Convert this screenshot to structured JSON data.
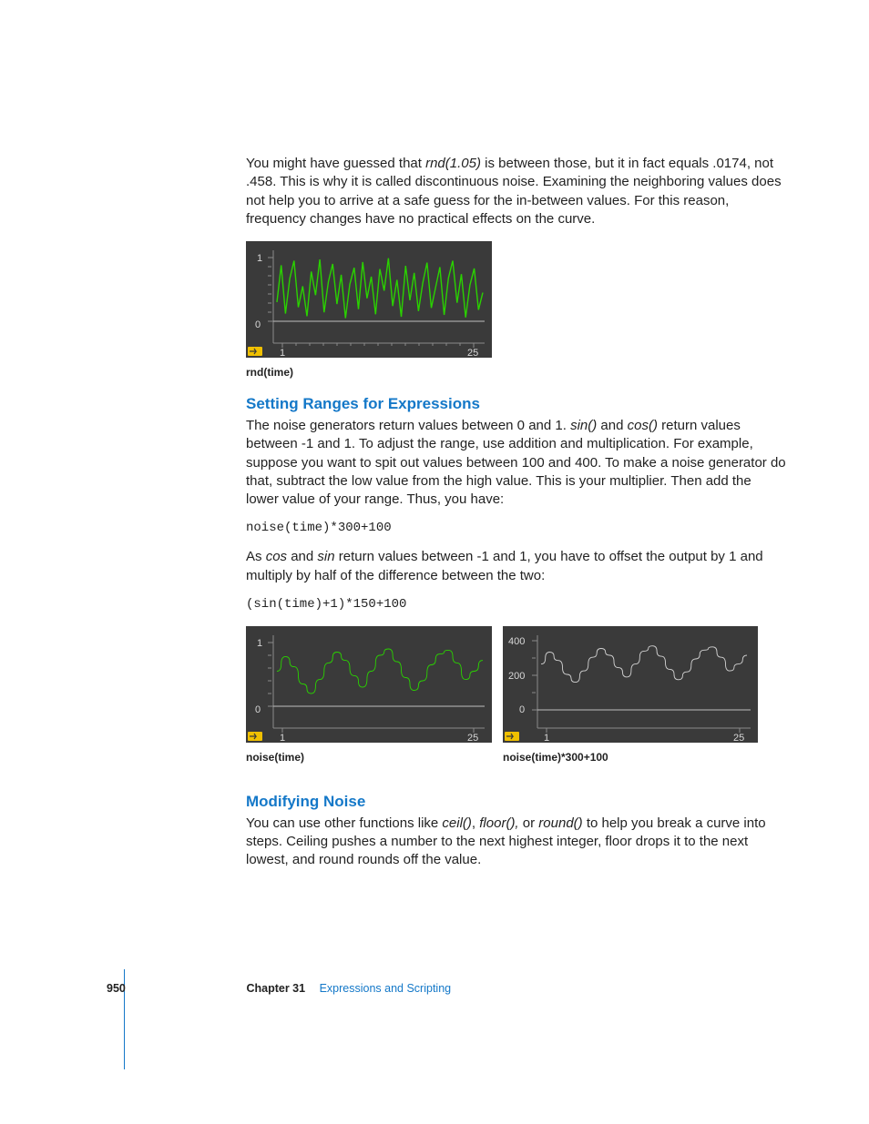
{
  "paragraphs": {
    "intro_a": "You might have guessed that ",
    "intro_rnd": "rnd(1.05)",
    "intro_b": " is between those, but it in fact equals .0174, not .458. This is why it is called discontinuous noise. Examining the neighboring values does not help you to arrive at a safe guess for the in-between values. For this reason, frequency changes have no practical effects on the curve.",
    "ranges_a": "The noise generators return values between 0 and 1. ",
    "ranges_sin": "sin()",
    "ranges_mid": " and ",
    "ranges_cos": "cos()",
    "ranges_b": " return values between -1 and 1. To adjust the range, use addition and multiplication. For example, suppose you want to spit out values between 100 and 400. To make a noise generator do that, subtract the low value from the high value. This is your multiplier. Then add the lower value of your range. Thus, you have:",
    "cos_a": "As ",
    "cos_i": "cos",
    "cos_b": " and ",
    "sin_i": "sin",
    "cos_c": " return values between -1 and 1, you have to offset the output by 1 and multiply by half of the difference between the two:",
    "mod_a": "You can use other functions like ",
    "mod_ceil": "ceil()",
    "mod_s1": ", ",
    "mod_floor": "floor(),",
    "mod_s2": " or ",
    "mod_round": "round()",
    "mod_b": " to help you break a curve into steps. Ceiling pushes a number to the next highest integer, floor drops it to the next lowest, and round rounds off the value."
  },
  "headings": {
    "ranges": "Setting Ranges for Expressions",
    "modify": "Modifying Noise"
  },
  "code": {
    "c1": "noise(time)*300+100",
    "c2": "(sin(time)+1)*150+100"
  },
  "captions": {
    "rnd": "rnd(time)",
    "pair_a": "noise(time)",
    "pair_b": "noise(time)*300+100"
  },
  "footer": {
    "page": "950",
    "chapter": "Chapter 31",
    "title": "Expressions and Scripting"
  },
  "chart_data": [
    {
      "name": "rnd_time",
      "type": "line",
      "title": "rnd(time)",
      "xlabel": "",
      "ylabel": "",
      "xlim": [
        1,
        25
      ],
      "ylim": [
        0,
        1
      ],
      "x_ticks": [
        1,
        25
      ],
      "y_ticks": [
        0,
        1
      ],
      "x": [
        1,
        1.5,
        2,
        2.5,
        3,
        3.5,
        4,
        4.5,
        5,
        5.5,
        6,
        6.5,
        7,
        7.5,
        8,
        8.5,
        9,
        9.5,
        10,
        10.5,
        11,
        11.5,
        12,
        12.5,
        13,
        13.5,
        14,
        14.5,
        15,
        15.5,
        16,
        16.5,
        17,
        17.5,
        18,
        18.5,
        19,
        19.5,
        20,
        20.5,
        21,
        21.5,
        22,
        22.5,
        23,
        23.5,
        24,
        24.5,
        25
      ],
      "y": [
        0.3,
        0.88,
        0.12,
        0.67,
        0.95,
        0.22,
        0.55,
        0.08,
        0.78,
        0.41,
        0.97,
        0.14,
        0.62,
        0.9,
        0.27,
        0.73,
        0.05,
        0.58,
        0.84,
        0.19,
        0.93,
        0.36,
        0.7,
        0.11,
        0.82,
        0.48,
        0.99,
        0.24,
        0.65,
        0.07,
        0.87,
        0.33,
        0.76,
        0.16,
        0.6,
        0.92,
        0.21,
        0.53,
        0.85,
        0.1,
        0.68,
        0.95,
        0.29,
        0.74,
        0.06,
        0.57,
        0.83,
        0.18,
        0.45
      ]
    },
    {
      "name": "noise_time",
      "type": "line",
      "title": "noise(time)",
      "xlabel": "",
      "ylabel": "",
      "xlim": [
        1,
        25
      ],
      "ylim": [
        0,
        1
      ],
      "x_ticks": [
        1,
        25
      ],
      "y_ticks": [
        0,
        1
      ],
      "x": [
        1,
        2,
        3,
        4,
        5,
        6,
        7,
        8,
        9,
        10,
        11,
        12,
        13,
        14,
        15,
        16,
        17,
        18,
        19,
        20,
        21,
        22,
        23,
        24,
        25
      ],
      "y": [
        0.55,
        0.78,
        0.62,
        0.35,
        0.2,
        0.42,
        0.68,
        0.85,
        0.72,
        0.48,
        0.3,
        0.55,
        0.8,
        0.9,
        0.7,
        0.45,
        0.25,
        0.4,
        0.65,
        0.82,
        0.88,
        0.68,
        0.42,
        0.55,
        0.72
      ]
    },
    {
      "name": "noise_scaled",
      "type": "line",
      "title": "noise(time)*300+100",
      "xlabel": "",
      "ylabel": "",
      "xlim": [
        1,
        25
      ],
      "ylim": [
        0,
        400
      ],
      "x_ticks": [
        1,
        25
      ],
      "y_ticks": [
        0,
        200,
        400
      ],
      "x": [
        1,
        2,
        3,
        4,
        5,
        6,
        7,
        8,
        9,
        10,
        11,
        12,
        13,
        14,
        15,
        16,
        17,
        18,
        19,
        20,
        21,
        22,
        23,
        24,
        25
      ],
      "y": [
        265,
        334,
        286,
        205,
        160,
        226,
        304,
        355,
        316,
        244,
        190,
        265,
        340,
        370,
        310,
        235,
        175,
        220,
        295,
        346,
        364,
        304,
        226,
        265,
        316
      ]
    }
  ]
}
